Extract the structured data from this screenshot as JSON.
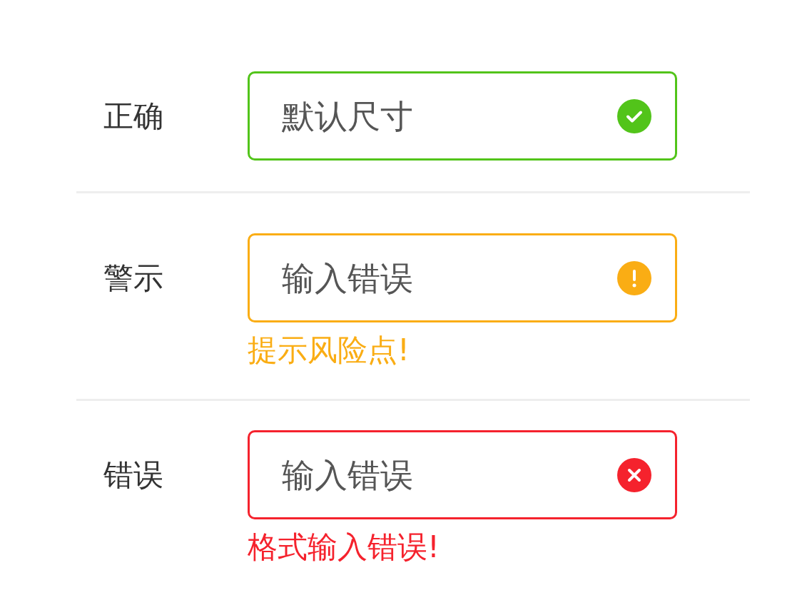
{
  "rows": [
    {
      "label": "正确",
      "kind": "success",
      "value": "默认尺寸"
    },
    {
      "label": "警示",
      "kind": "warning",
      "value": "输入错误",
      "hint": "提示风险点!"
    },
    {
      "label": "错误",
      "kind": "error",
      "value": "输入错误",
      "hint": "格式输入错误!"
    }
  ]
}
